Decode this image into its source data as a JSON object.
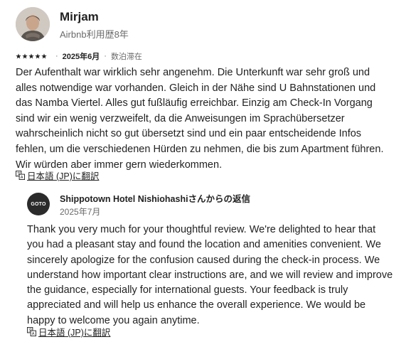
{
  "review": {
    "reviewer_name": "Mirjam",
    "reviewer_meta": "Airbnb利用歴8年",
    "rating": 5,
    "date": "2025年6月",
    "stay_type": "数泊滞在",
    "separator": "·",
    "text": "Der Aufenthalt war wirklich sehr angenehm. Die Unterkunft war sehr groß und alles notwendige war vorhanden. Gleich in der Nähe sind U Bahnstationen und das Namba Viertel. Alles gut fußläufig erreichbar. Einzig am Check-In Vorgang sind wir ein wenig verzweifelt, da die Anweisungen im Sprachübersetzer wahrscheinlich nicht so gut übersetzt sind und ein paar entscheidende Infos fehlen, um die verschiedenen Hürden zu nehmen, die bis zum Apartment führen. Wir würden aber immer gern wiederkommen.",
    "translate_label": "日本語 (JP)に翻訳"
  },
  "response": {
    "logo_text": "GOTO",
    "title": "Shippotown Hotel Nishiohashiさんからの返信",
    "date": "2025年7月",
    "text": "Thank you very much for your thoughtful review. We're delighted to hear that you had a pleasant stay and found the location and amenities convenient. We sincerely apologize for the confusion caused during the check-in process. We understand how important clear instructions are, and we will review and improve the guidance, especially for international guests. Your feedback is truly appreciated and will help us enhance the overall experience. We would be happy to welcome you again anytime.",
    "translate_label": "日本語 (JP)に翻訳"
  },
  "icons": {
    "star": "star-icon",
    "translate": "translate-icon"
  },
  "colors": {
    "text": "#222222",
    "muted": "#6a6a6a",
    "logo_bg": "#2b2b2b"
  }
}
